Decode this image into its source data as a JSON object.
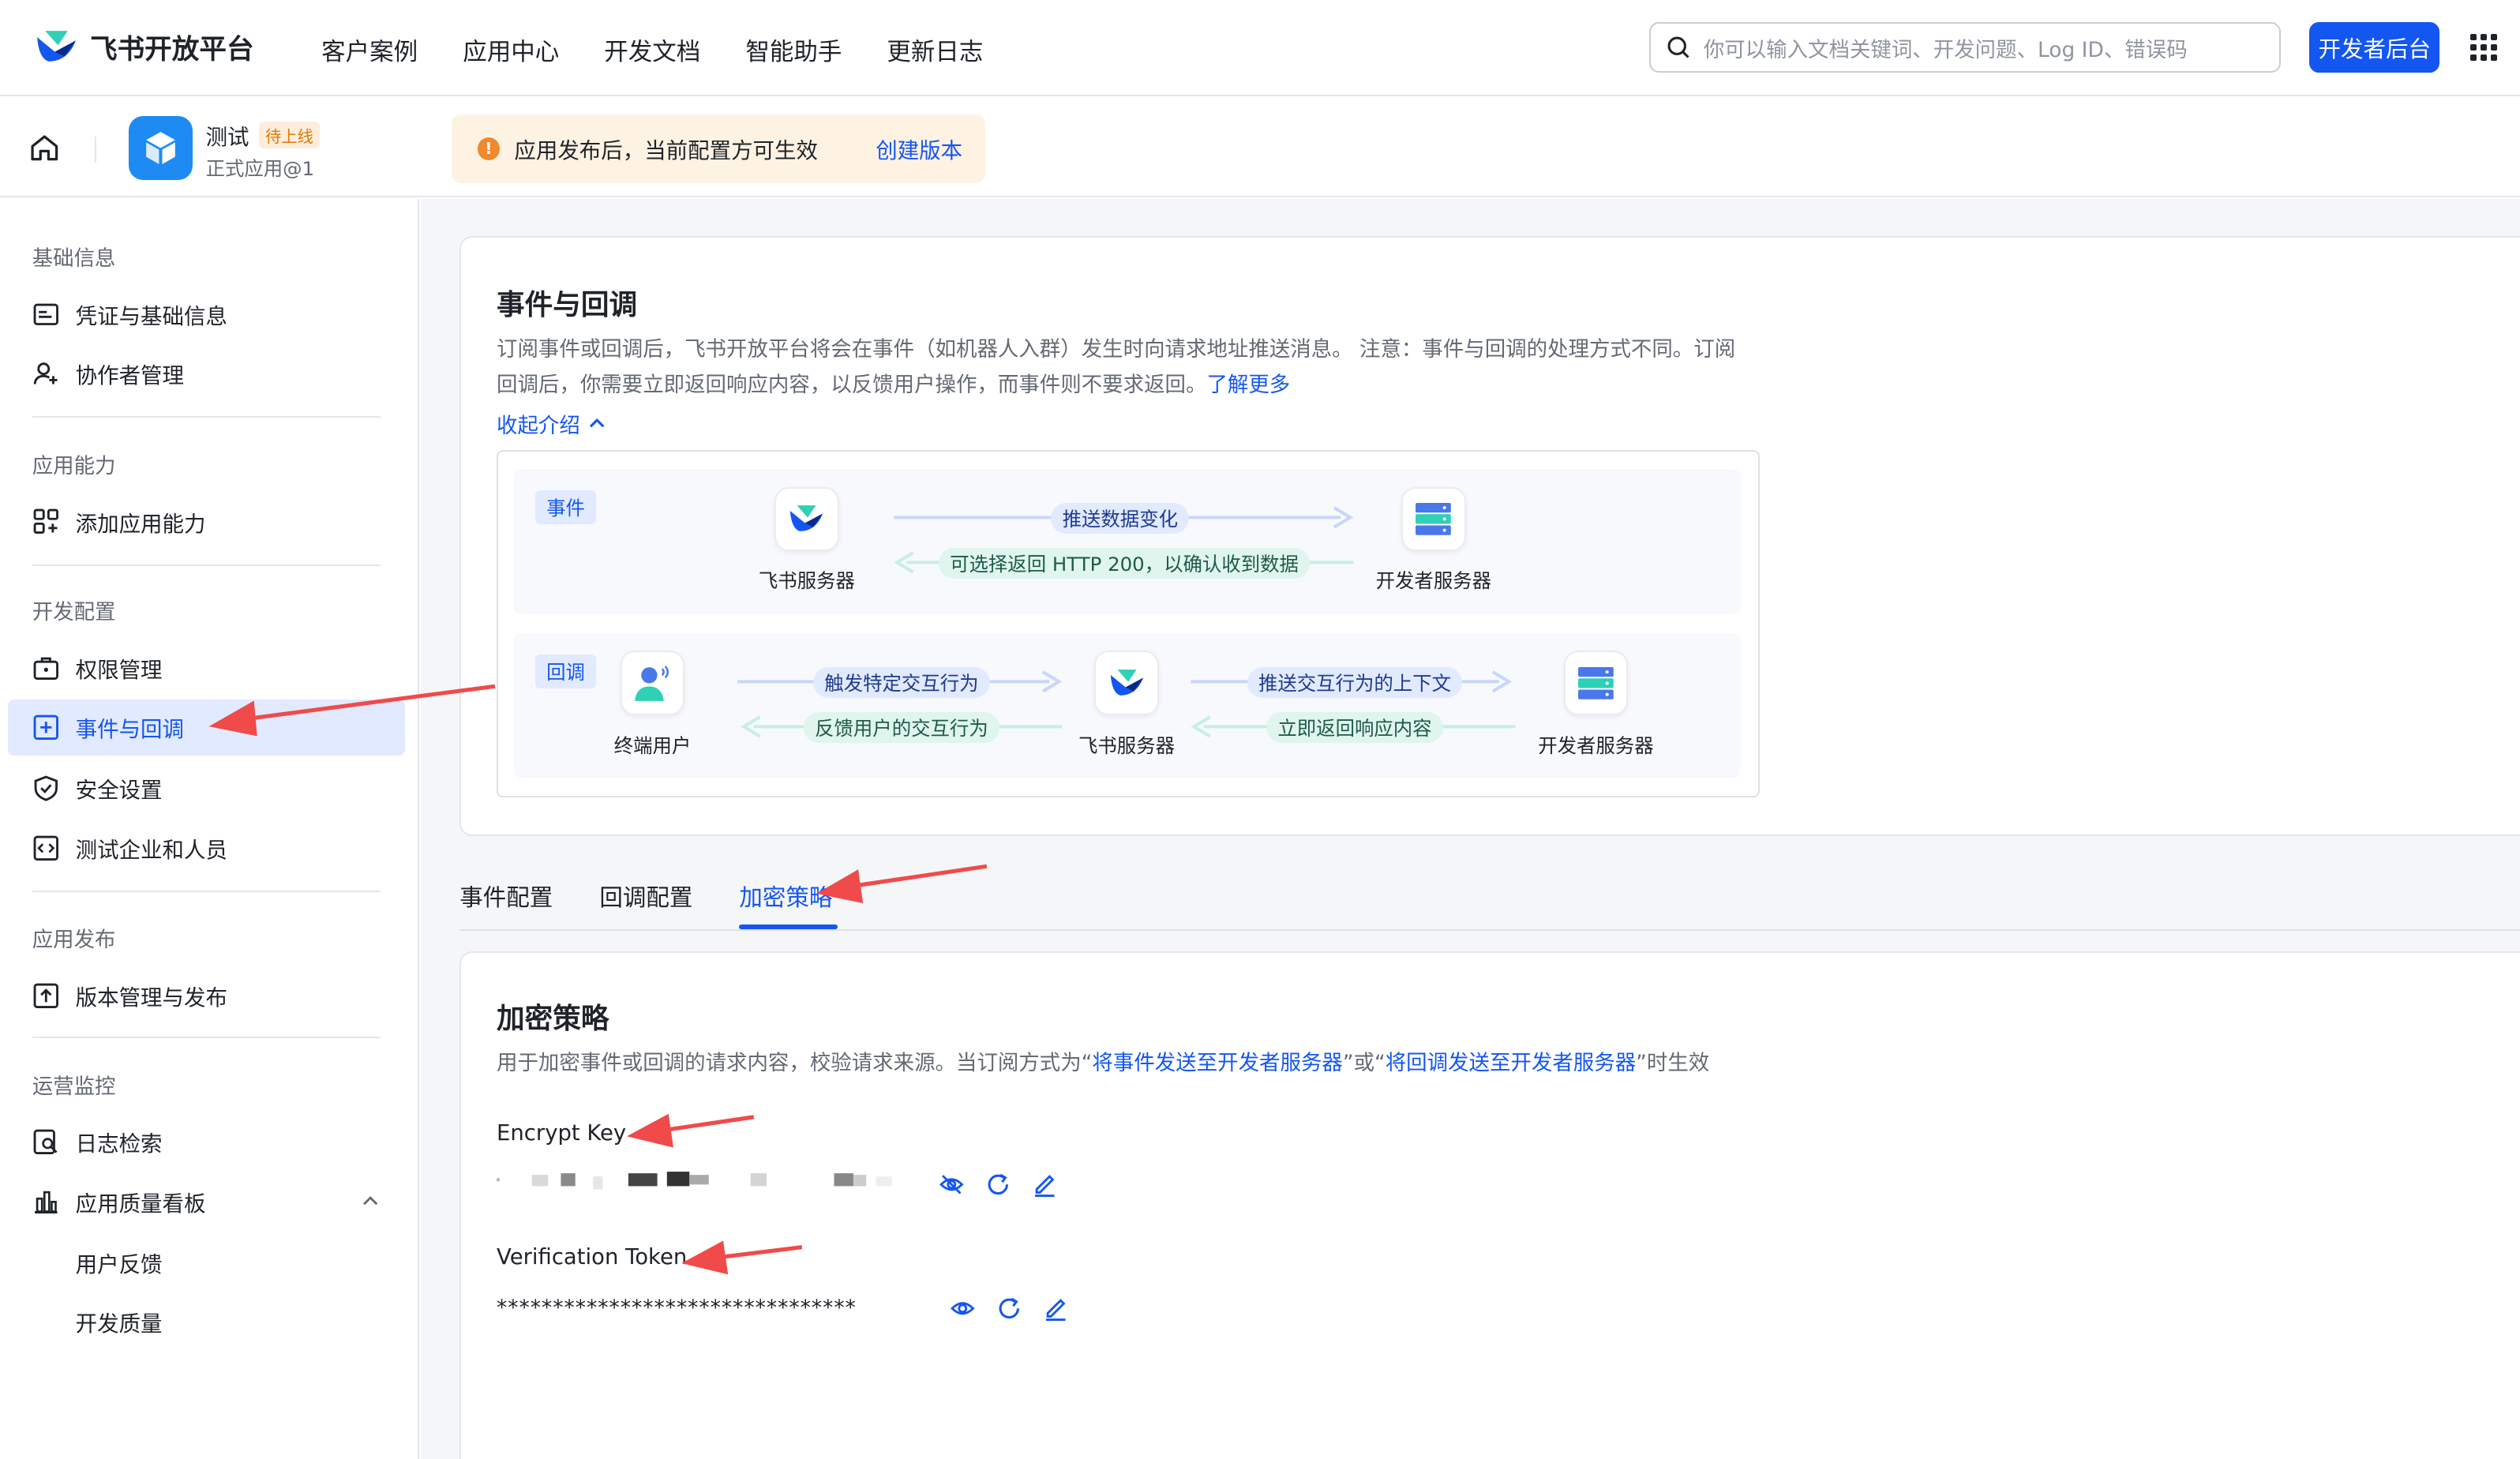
{
  "topbar": {
    "brand": "飞书开放平台",
    "nav": [
      "客户案例",
      "应用中心",
      "开发文档",
      "智能助手",
      "更新日志"
    ],
    "search_placeholder": "你可以输入文档关键词、开发问题、Log ID、错误码",
    "dev_button": "开发者后台"
  },
  "app": {
    "name": "测试",
    "status_badge": "待上线",
    "version": "正式应用@1"
  },
  "notice": {
    "text": "应用发布后，当前配置方可生效",
    "link": "创建版本"
  },
  "sidebar": {
    "sections": [
      "基础信息",
      "应用能力",
      "开发配置",
      "应用发布",
      "运营监控"
    ],
    "items": [
      "凭证与基础信息",
      "协作者管理",
      "添加应用能力",
      "权限管理",
      "事件与回调",
      "安全设置",
      "测试企业和人员",
      "版本管理与发布",
      "日志检索",
      "应用质量看板",
      "用户反馈",
      "开发质量"
    ],
    "active": "事件与回调"
  },
  "intro": {
    "title": "事件与回调",
    "desc_line1": "订阅事件或回调后，飞书开放平台将会在事件（如机器人入群）发生时向请求地址推送消息。 注意：事件与回调的处理方式不同。订阅",
    "desc_line2": "回调后，你需要立即返回响应内容，以反馈用户操作，而事件则不要求返回。",
    "learn_more": "了解更多",
    "collapse": "收起介绍"
  },
  "diagram": {
    "event_tag": "事件",
    "callback_tag": "回调",
    "feishu_server": "飞书服务器",
    "dev_server": "开发者服务器",
    "end_user": "终端用户",
    "push_data": "推送数据变化",
    "optional_return": "可选择返回 HTTP 200，以确认收到数据",
    "trigger": "触发特定交互行为",
    "feedback": "反馈用户的交互行为",
    "push_context": "推送交互行为的上下文",
    "return_now": "立即返回响应内容"
  },
  "tabs": {
    "items": [
      "事件配置",
      "回调配置",
      "加密策略"
    ],
    "active": "加密策略"
  },
  "encryption": {
    "title": "加密策略",
    "desc_pre": "用于加密事件或回调的请求内容，校验请求来源。当订阅方式为“",
    "desc_link1": "将事件发送至开发者服务器",
    "desc_mid": "”或“",
    "desc_link2": "将回调发送至开发者服务器",
    "desc_post": "”时生效",
    "encrypt_key_label": "Encrypt Key",
    "verification_token_label": "Verification Token",
    "verification_token_value": "********************************"
  },
  "colors": {
    "accent": "#1456f0",
    "annotation": "#f04a4a",
    "active_bg": "#e1eaff",
    "notice_bg": "#fef3e2"
  }
}
